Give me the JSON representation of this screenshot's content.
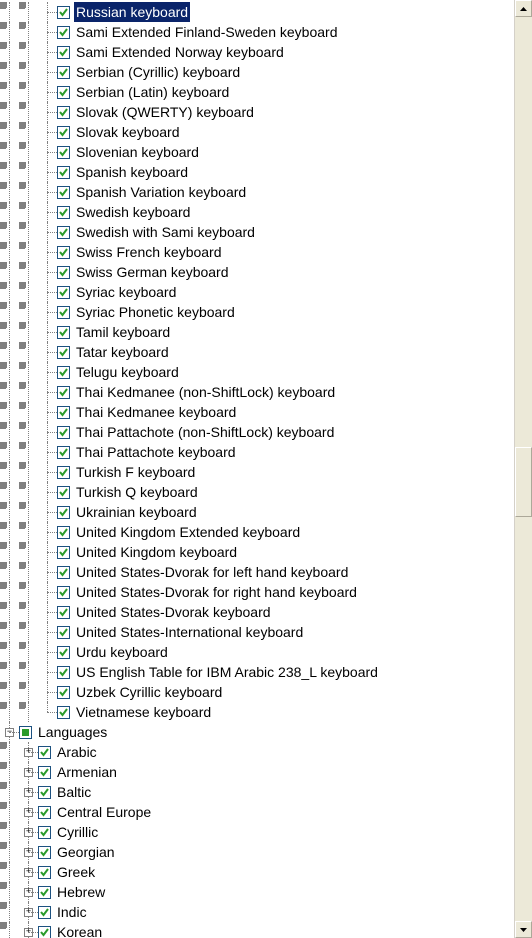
{
  "colors": {
    "selection_bg": "#0a246a",
    "selection_fg": "#ffffff",
    "check_green": "#2a9b2a"
  },
  "keyboards": [
    {
      "label": "Russian keyboard",
      "checked": true,
      "selected": true,
      "last": false
    },
    {
      "label": "Sami Extended Finland-Sweden keyboard",
      "checked": true,
      "selected": false,
      "last": false
    },
    {
      "label": "Sami Extended Norway keyboard",
      "checked": true,
      "selected": false,
      "last": false
    },
    {
      "label": "Serbian (Cyrillic) keyboard",
      "checked": true,
      "selected": false,
      "last": false
    },
    {
      "label": "Serbian (Latin) keyboard",
      "checked": true,
      "selected": false,
      "last": false
    },
    {
      "label": "Slovak (QWERTY) keyboard",
      "checked": true,
      "selected": false,
      "last": false
    },
    {
      "label": "Slovak keyboard",
      "checked": true,
      "selected": false,
      "last": false
    },
    {
      "label": "Slovenian keyboard",
      "checked": true,
      "selected": false,
      "last": false
    },
    {
      "label": "Spanish keyboard",
      "checked": true,
      "selected": false,
      "last": false
    },
    {
      "label": "Spanish Variation keyboard",
      "checked": true,
      "selected": false,
      "last": false
    },
    {
      "label": "Swedish keyboard",
      "checked": true,
      "selected": false,
      "last": false
    },
    {
      "label": "Swedish with Sami keyboard",
      "checked": true,
      "selected": false,
      "last": false
    },
    {
      "label": "Swiss French keyboard",
      "checked": true,
      "selected": false,
      "last": false
    },
    {
      "label": "Swiss German keyboard",
      "checked": true,
      "selected": false,
      "last": false
    },
    {
      "label": "Syriac keyboard",
      "checked": true,
      "selected": false,
      "last": false
    },
    {
      "label": "Syriac Phonetic keyboard",
      "checked": true,
      "selected": false,
      "last": false
    },
    {
      "label": "Tamil keyboard",
      "checked": true,
      "selected": false,
      "last": false
    },
    {
      "label": "Tatar keyboard",
      "checked": true,
      "selected": false,
      "last": false
    },
    {
      "label": "Telugu keyboard",
      "checked": true,
      "selected": false,
      "last": false
    },
    {
      "label": "Thai Kedmanee (non-ShiftLock) keyboard",
      "checked": true,
      "selected": false,
      "last": false
    },
    {
      "label": "Thai Kedmanee keyboard",
      "checked": true,
      "selected": false,
      "last": false
    },
    {
      "label": "Thai Pattachote (non-ShiftLock) keyboard",
      "checked": true,
      "selected": false,
      "last": false
    },
    {
      "label": "Thai Pattachote keyboard",
      "checked": true,
      "selected": false,
      "last": false
    },
    {
      "label": "Turkish F keyboard",
      "checked": true,
      "selected": false,
      "last": false
    },
    {
      "label": "Turkish Q keyboard",
      "checked": true,
      "selected": false,
      "last": false
    },
    {
      "label": "Ukrainian keyboard",
      "checked": true,
      "selected": false,
      "last": false
    },
    {
      "label": "United Kingdom Extended keyboard",
      "checked": true,
      "selected": false,
      "last": false
    },
    {
      "label": "United Kingdom keyboard",
      "checked": true,
      "selected": false,
      "last": false
    },
    {
      "label": "United States-Dvorak for left hand keyboard",
      "checked": true,
      "selected": false,
      "last": false
    },
    {
      "label": "United States-Dvorak for right hand keyboard",
      "checked": true,
      "selected": false,
      "last": false
    },
    {
      "label": "United States-Dvorak keyboard",
      "checked": true,
      "selected": false,
      "last": false
    },
    {
      "label": "United States-International keyboard",
      "checked": true,
      "selected": false,
      "last": false
    },
    {
      "label": "Urdu keyboard",
      "checked": true,
      "selected": false,
      "last": false
    },
    {
      "label": "US English Table for IBM Arabic 238_L keyboard",
      "checked": true,
      "selected": false,
      "last": false
    },
    {
      "label": "Uzbek Cyrillic keyboard",
      "checked": true,
      "selected": false,
      "last": false
    },
    {
      "label": "Vietnamese keyboard",
      "checked": true,
      "selected": false,
      "last": true
    }
  ],
  "languages_header": {
    "label": "Languages",
    "checked": "indeterminate",
    "expanded": true
  },
  "languages": [
    {
      "label": "Arabic",
      "checked": true,
      "expandable": true
    },
    {
      "label": "Armenian",
      "checked": true,
      "expandable": true
    },
    {
      "label": "Baltic",
      "checked": true,
      "expandable": true
    },
    {
      "label": "Central Europe",
      "checked": true,
      "expandable": true
    },
    {
      "label": "Cyrillic",
      "checked": true,
      "expandable": true
    },
    {
      "label": "Georgian",
      "checked": true,
      "expandable": true
    },
    {
      "label": "Greek",
      "checked": true,
      "expandable": true
    },
    {
      "label": "Hebrew",
      "checked": true,
      "expandable": true
    },
    {
      "label": "Indic",
      "checked": true,
      "expandable": true
    },
    {
      "label": "Korean",
      "checked": true,
      "expandable": true
    }
  ]
}
